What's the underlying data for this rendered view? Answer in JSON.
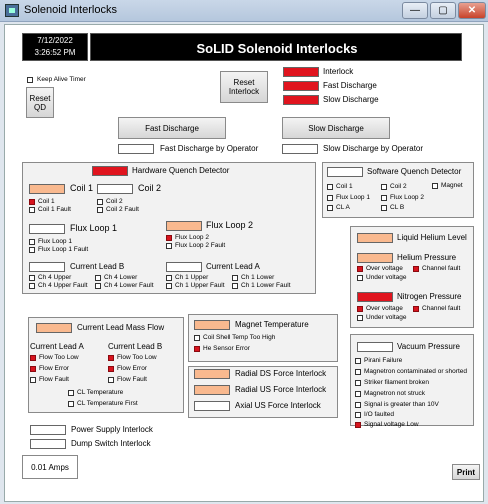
{
  "window": {
    "title": "Solenoid Interlocks",
    "minimize": "—",
    "maximize": "▢",
    "close": "✕"
  },
  "header": {
    "date": "7/12/2022",
    "time": "3:26:52 PM",
    "title": "SoLID Solenoid Interlocks"
  },
  "keep_alive": {
    "label": "Keep Alive Timer"
  },
  "reset_qd": "Reset QD",
  "reset_interlock": "Reset Interlock",
  "legend": {
    "interlock": "Interlock",
    "fast": "Fast Discharge",
    "slow": "Slow Discharge"
  },
  "fast_btn": "Fast Discharge",
  "slow_btn": "Slow Discharge",
  "fast_operator": "Fast Discharge by Operator",
  "slow_operator": "Slow Discharge by Operator",
  "hqd": {
    "title": "Hardware Quench Detector",
    "coil1": "Coil 1",
    "coil2": "Coil 2",
    "cb_coil1": "Coil 1",
    "cb_coil1_fault": "Coil 1 Fault",
    "cb_coil2": "Coil 2",
    "cb_coil2_fault": "Coil 2 Fault",
    "fl1": "Flux Loop 1",
    "fl2": "Flux Loop 2",
    "cb_fl1": "Flux Loop 1",
    "cb_fl1_fault": "Flux Loop 1 Fault",
    "cb_fl2": "Flux Loop 2",
    "cb_fl2_fault": "Flux Loop 2 Fault",
    "clb": "Current Lead B",
    "cla": "Current Lead A",
    "ch4u": "Ch 4 Upper",
    "ch4l": "Ch 4 Lower",
    "ch1u": "Ch 1 Upper",
    "ch1l": "Ch 1 Lower",
    "ch4uf": "Ch 4 Upper Fault",
    "ch4lf": "Ch 4 Lower Fault",
    "ch1uf": "Ch 1 Upper Fault",
    "ch1lf": "Ch 1 Lower Fault"
  },
  "sqd": {
    "title": "Software Quench Detector",
    "coil1": "Coil 1",
    "coil2": "Coil 2",
    "magnet": "Magnet",
    "fl1": "Flux Loop 1",
    "fl2": "Flux Loop 2",
    "cla": "CL A",
    "clb": "CL B"
  },
  "lhe": {
    "title": "Liquid Helium Level"
  },
  "he_pressure": {
    "title": "Helium Pressure",
    "over": "Over voltage",
    "fault": "Channel fault",
    "under": "Under voltage"
  },
  "n2_pressure": {
    "title": "Nitrogen Pressure",
    "over": "Over voltage",
    "fault": "Channel fault",
    "under": "Under voltage"
  },
  "clmf": {
    "title": "Current Lead Mass Flow",
    "cla": "Current Lead A",
    "clb": "Current Lead B",
    "low": "Flow Too Low",
    "err": "Flow Error",
    "fault": "Flow Fault",
    "temp": "CL Temperature",
    "temp_first": "CL Temperature First"
  },
  "mag_temp": {
    "title": "Magnet Temperature",
    "coil_shell": "Coil Shell Temp Too High",
    "he_sensor": "He Sensor Error"
  },
  "force": {
    "rds": "Radial DS Force Interlock",
    "rus": "Radial US Force Interlock",
    "aus": "Axial US Force Interlock"
  },
  "vacuum": {
    "title": "Vacuum Pressure",
    "items": [
      "Pirani Failure",
      "Magnetron contaminated or shorted",
      "Striker filament broken",
      "Magnetron not struck",
      "Signal is greater than 10V",
      "I/O faulted",
      "Signal voltage Low"
    ]
  },
  "power_supply": "Power Supply Interlock",
  "dump_switch": "Dump Switch Interlock",
  "amps": "0.01 Amps",
  "print": "Print",
  "colors": {
    "alarm_red": "#e0141e",
    "indicator_orange": "#f9b98f",
    "header_bg": "#000000"
  }
}
